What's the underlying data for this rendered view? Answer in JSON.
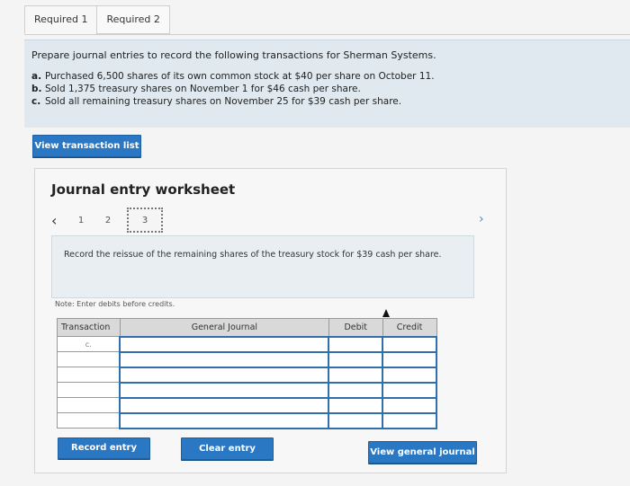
{
  "tabs": [
    {
      "label": "Required 1"
    },
    {
      "label": "Required 2"
    }
  ],
  "instructions": {
    "intro": "Prepare journal entries to record the following transactions for Sherman Systems.",
    "items": [
      {
        "letter": "a.",
        "text": "Purchased 6,500 shares of its own common stock at $40 per share on October 11."
      },
      {
        "letter": "b.",
        "text": "Sold 1,375 treasury shares on November 1 for $46 cash per share."
      },
      {
        "letter": "c.",
        "text": "Sold all remaining treasury shares on November 25 for $39 cash per share."
      }
    ]
  },
  "buttons": {
    "view_transaction_list": "View transaction list",
    "record_entry": "Record entry",
    "clear_entry": "Clear entry",
    "view_general_journal": "View general journal"
  },
  "worksheet": {
    "title": "Journal entry worksheet",
    "pages": [
      "1",
      "2",
      "3"
    ],
    "current_page": "3",
    "description": "Record the reissue of the remaining shares of the treasury stock for $39 cash per share.",
    "note": "Note: Enter debits before credits.",
    "table": {
      "headers": {
        "transaction": "Transaction",
        "general_journal": "General Journal",
        "debit": "Debit",
        "credit": "Credit"
      },
      "first_transaction": "c."
    }
  },
  "colors": {
    "accent": "#2a78c4",
    "panel": "#dfe9ef"
  },
  "icons": {
    "prev": "chevron-left-icon",
    "next": "chevron-right-icon"
  }
}
